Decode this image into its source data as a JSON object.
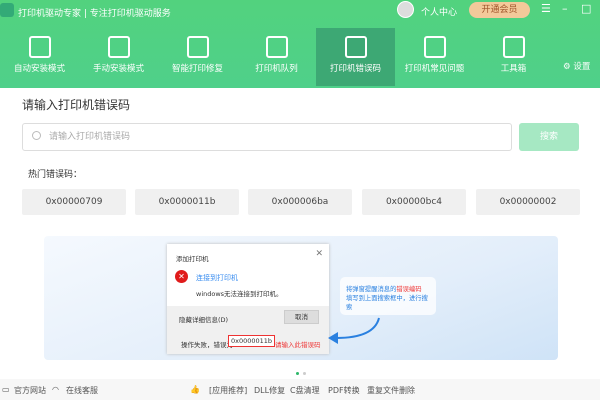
{
  "app": {
    "title": "打印机驱动专家 | 专注打印机驱动服务",
    "user_center": "个人中心",
    "vip": "开通会员"
  },
  "nav": [
    {
      "label": "自动安装模式"
    },
    {
      "label": "手动安装模式"
    },
    {
      "label": "智能打印修复"
    },
    {
      "label": "打印机队列"
    },
    {
      "label": "打印机错误码"
    },
    {
      "label": "打印机常见问题"
    },
    {
      "label": "工具箱"
    },
    {
      "label": "设置"
    }
  ],
  "main": {
    "heading": "请输入打印机错误码",
    "search_placeholder": "请输入打印机错误码",
    "search_button": "搜索",
    "hot_label": "热门错误码：",
    "codes": [
      "0x00000709",
      "0x0000011b",
      "0x000006ba",
      "0x00000bc4",
      "0x00000002"
    ]
  },
  "banner": {
    "dialog_title": "添加打印机",
    "dialog_heading": "连接到打印机",
    "dialog_message": "windows无法连接到打印机。",
    "details": "隐藏详细信息(D)",
    "cancel": "取消",
    "fail_text": "操作失败，错误为",
    "code": "0x0000011b",
    "hint": "请输入此错误码",
    "tip_line1_a": "将弹窗提醒消息的",
    "tip_line1_b": "错误编码",
    "tip_line2": "填写到上面搜索框中，进行搜索"
  },
  "footer": {
    "website": "官方网站",
    "support": "在线客服",
    "recommend": "[应用推荐]",
    "dll": "DLL修复",
    "cdisk": "C盘清理",
    "pdf": "PDF转换",
    "dup": "重复文件删除"
  }
}
